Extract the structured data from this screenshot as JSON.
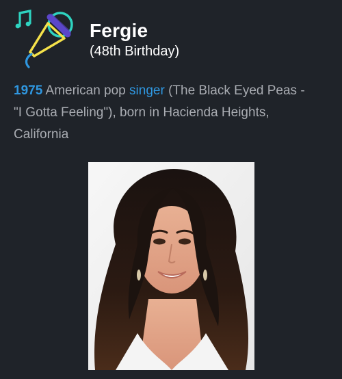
{
  "header": {
    "icon": "singer-microphone-music-icon",
    "name": "Fergie",
    "subtitle": "(48th Birthday)"
  },
  "entry": {
    "year": "1975",
    "text_before_link": "American pop",
    "link_text": "singer",
    "text_after_link": "(The Black Eyed Peas - \"I Gotta Feeling\"), born in Hacienda Heights, California"
  },
  "photo": {
    "subject": "portrait-photo"
  },
  "colors": {
    "background": "#1f2329",
    "accent_blue": "#2f97e0",
    "icon_yellow": "#f5e24a",
    "icon_teal": "#2ed3c0",
    "icon_purple": "#5b46c9"
  }
}
